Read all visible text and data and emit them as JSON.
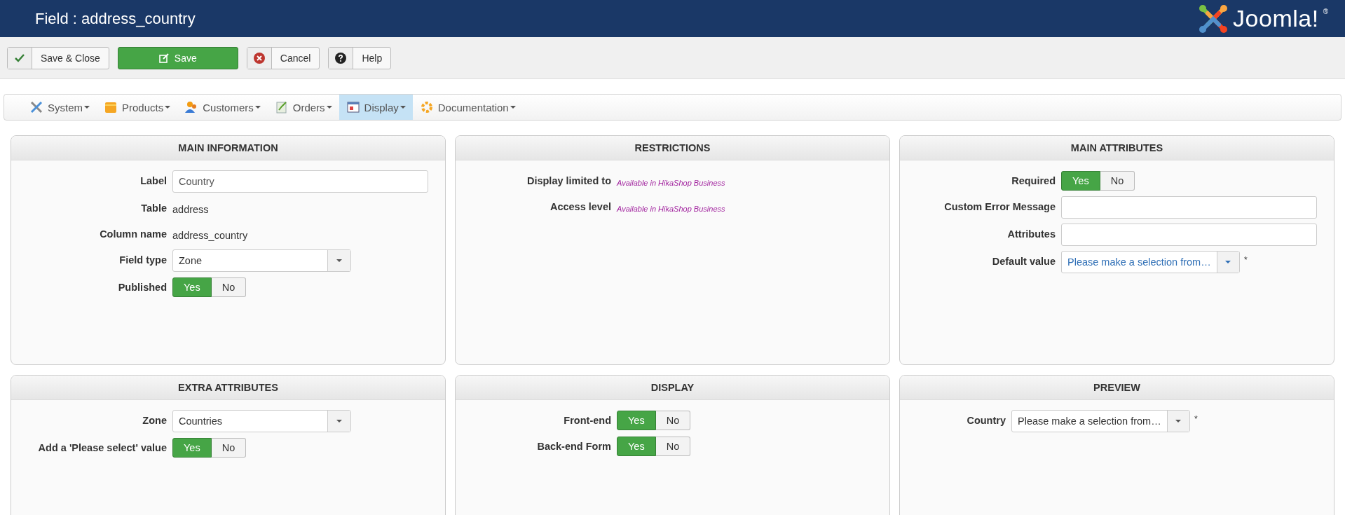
{
  "header": {
    "title": "Field : address_country",
    "logo_text": "Joomla!",
    "logo_mark": "®"
  },
  "toolbar": [
    {
      "label": "Save & Close",
      "kind": "default"
    },
    {
      "label": "Save",
      "kind": "primary"
    },
    {
      "label": "Cancel",
      "kind": "default"
    },
    {
      "label": "Help",
      "kind": "default"
    }
  ],
  "menu": [
    {
      "label": "System",
      "selected": false
    },
    {
      "label": "Products",
      "selected": false
    },
    {
      "label": "Customers",
      "selected": false
    },
    {
      "label": "Orders",
      "selected": false
    },
    {
      "label": "Display",
      "selected": true
    },
    {
      "label": "Documentation",
      "selected": false
    }
  ],
  "panels": [
    {
      "title": "MAIN INFORMATION",
      "rows": [
        {
          "kind": "input",
          "label": "Label",
          "value": "Country"
        },
        {
          "kind": "text",
          "label": "Table",
          "value": "address"
        },
        {
          "kind": "text",
          "label": "Column name",
          "value": "address_country"
        },
        {
          "kind": "select",
          "label": "Field type",
          "value": "Zone"
        },
        {
          "kind": "toggle",
          "label": "Published",
          "options": [
            {
              "label": "Yes",
              "selected": true
            },
            {
              "label": "No",
              "selected": false
            }
          ]
        }
      ]
    },
    {
      "title": "RESTRICTIONS",
      "rows": [
        {
          "kind": "note",
          "label": "Display limited to",
          "value": "Available in HikaShop Business"
        },
        {
          "kind": "note",
          "label": "Access level",
          "value": "Available in HikaShop Business"
        }
      ]
    },
    {
      "title": "MAIN ATTRIBUTES",
      "rows": [
        {
          "kind": "toggle",
          "label": "Required",
          "options": [
            {
              "label": "Yes",
              "selected": true
            },
            {
              "label": "No",
              "selected": false
            }
          ]
        },
        {
          "kind": "input",
          "label": "Custom Error Message"
        },
        {
          "kind": "input",
          "label": "Attributes"
        },
        {
          "kind": "chosen",
          "label": "Default value",
          "value": "Please make a selection from…",
          "suffix": "*"
        }
      ]
    },
    {
      "title": "EXTRA ATTRIBUTES",
      "rows": [
        {
          "kind": "select",
          "label": "Zone",
          "value": "Countries"
        },
        {
          "kind": "toggle",
          "label": "Add a 'Please select' value",
          "options": [
            {
              "label": "Yes",
              "selected": true
            },
            {
              "label": "No",
              "selected": false
            }
          ]
        }
      ]
    },
    {
      "title": "DISPLAY",
      "rows": [
        {
          "kind": "toggle",
          "label": "Front-end",
          "options": [
            {
              "label": "Yes",
              "selected": true
            },
            {
              "label": "No",
              "selected": false
            }
          ]
        },
        {
          "kind": "toggle",
          "label": "Back-end Form",
          "options": [
            {
              "label": "Yes",
              "selected": true
            },
            {
              "label": "No",
              "selected": false
            }
          ]
        }
      ]
    },
    {
      "title": "PREVIEW",
      "rows": [
        {
          "kind": "select",
          "label": "Country",
          "value": "Please make a selection from…",
          "suffix": "*"
        }
      ]
    }
  ]
}
